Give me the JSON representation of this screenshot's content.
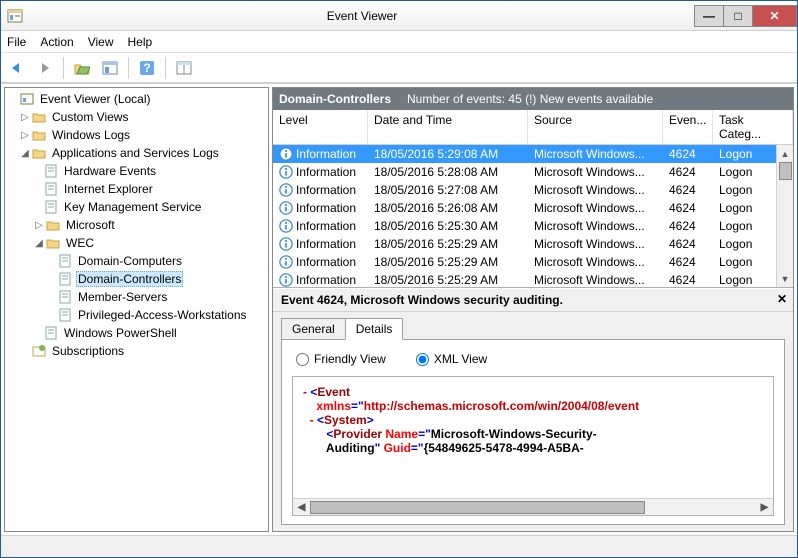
{
  "window": {
    "title": "Event Viewer"
  },
  "menu": {
    "file": "File",
    "action": "Action",
    "view": "View",
    "help": "Help"
  },
  "tree": {
    "root": "Event Viewer (Local)",
    "custom": "Custom Views",
    "winlogs": "Windows Logs",
    "appsvc": "Applications and Services Logs",
    "hw": "Hardware Events",
    "ie": "Internet Explorer",
    "kms": "Key Management Service",
    "ms": "Microsoft",
    "wec": "WEC",
    "dc_comp": "Domain-Computers",
    "dc_ctrl": "Domain-Controllers",
    "mem": "Member-Servers",
    "paw": "Privileged-Access-Workstations",
    "ps": "Windows PowerShell",
    "subs": "Subscriptions"
  },
  "list_header": {
    "name": "Domain-Controllers",
    "count": "Number of events: 45 (!) New events available"
  },
  "columns": {
    "level": "Level",
    "dt": "Date and Time",
    "src": "Source",
    "eid": "Even...",
    "cat": "Task Categ..."
  },
  "rows": [
    {
      "level": "Information",
      "dt": "18/05/2016 5:29:08 AM",
      "src": "Microsoft Windows...",
      "eid": "4624",
      "cat": "Logon"
    },
    {
      "level": "Information",
      "dt": "18/05/2016 5:28:08 AM",
      "src": "Microsoft Windows...",
      "eid": "4624",
      "cat": "Logon"
    },
    {
      "level": "Information",
      "dt": "18/05/2016 5:27:08 AM",
      "src": "Microsoft Windows...",
      "eid": "4624",
      "cat": "Logon"
    },
    {
      "level": "Information",
      "dt": "18/05/2016 5:26:08 AM",
      "src": "Microsoft Windows...",
      "eid": "4624",
      "cat": "Logon"
    },
    {
      "level": "Information",
      "dt": "18/05/2016 5:25:30 AM",
      "src": "Microsoft Windows...",
      "eid": "4624",
      "cat": "Logon"
    },
    {
      "level": "Information",
      "dt": "18/05/2016 5:25:29 AM",
      "src": "Microsoft Windows...",
      "eid": "4624",
      "cat": "Logon"
    },
    {
      "level": "Information",
      "dt": "18/05/2016 5:25:29 AM",
      "src": "Microsoft Windows...",
      "eid": "4624",
      "cat": "Logon"
    },
    {
      "level": "Information",
      "dt": "18/05/2016 5:25:29 AM",
      "src": "Microsoft Windows...",
      "eid": "4624",
      "cat": "Logon"
    }
  ],
  "detail": {
    "title": "Event 4624, Microsoft Windows security auditing.",
    "tab_general": "General",
    "tab_details": "Details",
    "friendly": "Friendly View",
    "xml": "XML View",
    "xml_lines": {
      "l1a": "<",
      "l1b": "Event",
      "l2a": "xmlns",
      "l2b": "=\"",
      "l2c": "http://schemas.microsoft.com/win/2004/08/event",
      "l3a": "<",
      "l3b": "System",
      "l3c": ">",
      "l4a": "<",
      "l4b": "Provider ",
      "l4c": "Name",
      "l4d": "=\"",
      "l4e": "Microsoft-Windows-Security-",
      "l5a": "Auditing",
      "l5b": "\" ",
      "l5c": "Guid",
      "l5d": "=\"",
      "l5e": "{54849625-5478-4994-A5BA-"
    }
  }
}
